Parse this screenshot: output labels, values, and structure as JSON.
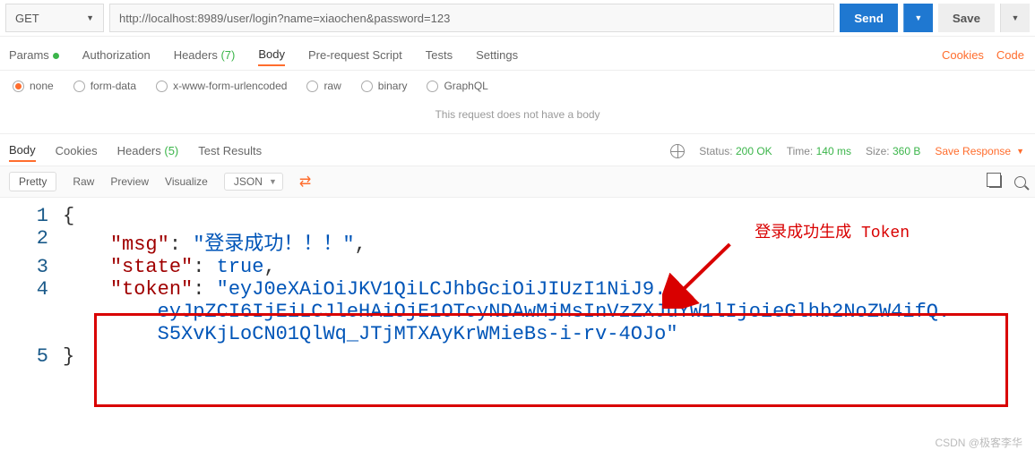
{
  "request": {
    "method": "GET",
    "url": "http://localhost:8989/user/login?name=xiaochen&password=123"
  },
  "buttons": {
    "send": "Send",
    "save": "Save"
  },
  "reqTabs": {
    "params": "Params",
    "auth": "Authorization",
    "headers": "Headers",
    "headersCount": "(7)",
    "body": "Body",
    "prerequest": "Pre-request Script",
    "tests": "Tests",
    "settings": "Settings"
  },
  "rightLinks": {
    "cookies": "Cookies",
    "code": "Code"
  },
  "bodyTypes": {
    "none": "none",
    "form": "form-data",
    "xform": "x-www-form-urlencoded",
    "raw": "raw",
    "binary": "binary",
    "graphql": "GraphQL"
  },
  "noBody": "This request does not have a body",
  "respTabs": {
    "body": "Body",
    "cookies": "Cookies",
    "headers": "Headers",
    "headersCount": "(5)",
    "tests": "Test Results"
  },
  "respMeta": {
    "statusLabel": "Status:",
    "statusValue": "200 OK",
    "timeLabel": "Time:",
    "timeValue": "140 ms",
    "sizeLabel": "Size:",
    "sizeValue": "360 B",
    "saveResponse": "Save Response"
  },
  "viewTabs": {
    "pretty": "Pretty",
    "raw": "Raw",
    "preview": "Preview",
    "visualize": "Visualize",
    "lang": "JSON"
  },
  "json": {
    "msgKey": "\"msg\"",
    "msgVal": "\"登录成功！！！\"",
    "stateKey": "\"state\"",
    "stateVal": "true",
    "tokenKey": "\"token\"",
    "tokenLine1": "\"eyJ0eXAiOiJKV1QiLCJhbGciOiJIUzI1NiJ9.",
    "tokenLine2": "eyJpZCI6IjEiLCJleHAiOjE1OTcyNDAwMjMsInVzZXJuYW1lIjoieGlhb2NoZW4ifQ.",
    "tokenLine3": "S5XvKjLoCN01QlWq_JTjMTXAyKrWMieBs-i-rv-4OJo\"",
    "open": "{",
    "close": "}",
    "ln1": "1",
    "ln2": "2",
    "ln3": "3",
    "ln4": "4",
    "ln5": "5"
  },
  "annotation": {
    "label": "登录成功生成 Token"
  },
  "watermark": "CSDN @极客李华"
}
